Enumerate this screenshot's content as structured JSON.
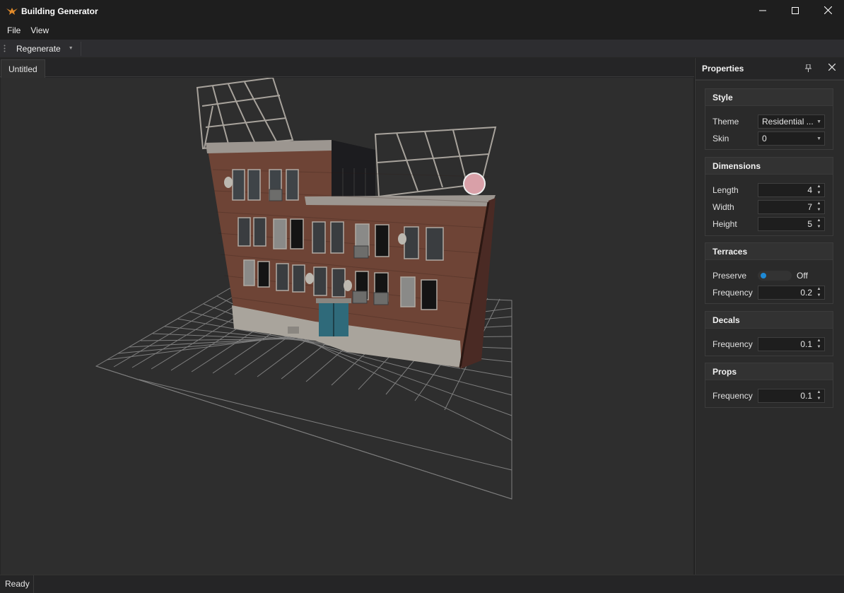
{
  "window": {
    "title": "Building Generator",
    "app_icon": "building-generator-logo",
    "minimize_icon": "minimize-icon",
    "maximize_icon": "maximize-icon",
    "close_icon": "close-icon"
  },
  "menu": {
    "items": [
      {
        "label": "File"
      },
      {
        "label": "View"
      }
    ]
  },
  "toolbar": {
    "regenerate_label": "Regenerate"
  },
  "document": {
    "tabs": [
      {
        "label": "Untitled",
        "active": true
      }
    ]
  },
  "viewport": {
    "content": "3d-building-model",
    "grid": true,
    "background": "#2e2e2e"
  },
  "properties": {
    "title": "Properties",
    "groups": {
      "style": {
        "header": "Style",
        "theme": {
          "label": "Theme",
          "value": "Residential ..."
        },
        "skin": {
          "label": "Skin",
          "value": "0"
        }
      },
      "dimensions": {
        "header": "Dimensions",
        "length": {
          "label": "Length",
          "value": "4"
        },
        "width": {
          "label": "Width",
          "value": "7"
        },
        "height": {
          "label": "Height",
          "value": "5"
        }
      },
      "terraces": {
        "header": "Terraces",
        "preserve": {
          "label": "Preserve",
          "state": "Off"
        },
        "frequency": {
          "label": "Frequency",
          "value": "0.2"
        }
      },
      "decals": {
        "header": "Decals",
        "frequency": {
          "label": "Frequency",
          "value": "0.1"
        }
      },
      "props": {
        "header": "Props",
        "frequency": {
          "label": "Frequency",
          "value": "0.1"
        }
      }
    }
  },
  "status": {
    "text": "Ready"
  },
  "colors": {
    "accent": "#1e8ad6",
    "brick": "#7a4a3a",
    "door": "#2f6a7a",
    "grid": "#8a8a8a"
  }
}
